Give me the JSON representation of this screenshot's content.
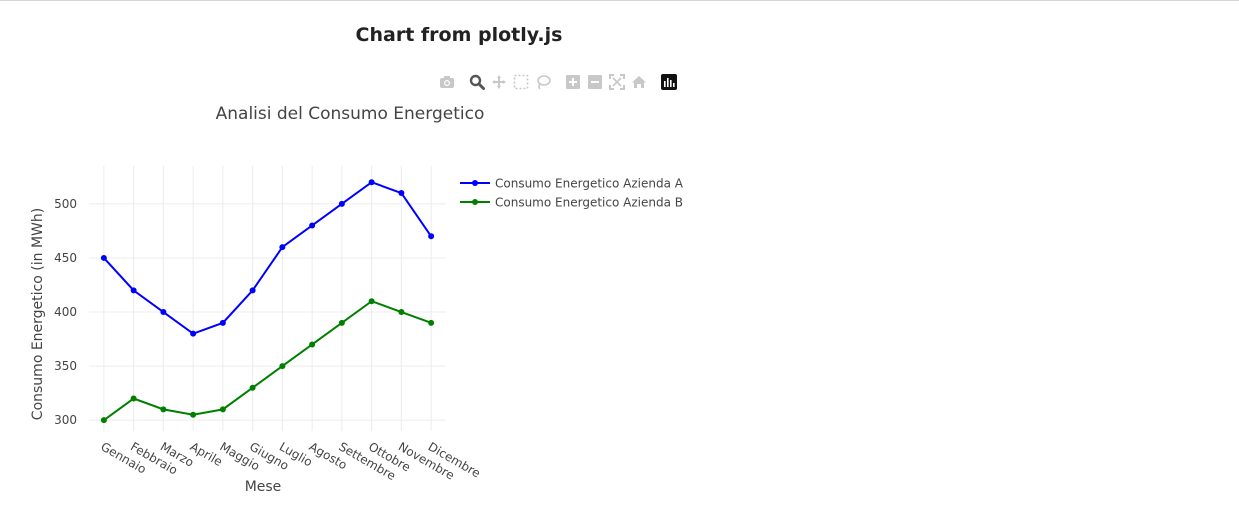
{
  "page": {
    "title": "Chart from plotly.js"
  },
  "modebar": {
    "buttons": [
      {
        "name": "camera-icon",
        "label": "Download plot as a png"
      },
      {
        "name": "zoom-icon",
        "label": "Zoom"
      },
      {
        "name": "pan-icon",
        "label": "Pan"
      },
      {
        "name": "box-select-icon",
        "label": "Box Select"
      },
      {
        "name": "lasso-select-icon",
        "label": "Lasso Select"
      },
      {
        "name": "zoom-in-icon",
        "label": "Zoom in"
      },
      {
        "name": "zoom-out-icon",
        "label": "Zoom out"
      },
      {
        "name": "autoscale-icon",
        "label": "Autoscale"
      },
      {
        "name": "reset-axes-icon",
        "label": "Reset axes"
      },
      {
        "name": "plotly-logo-icon",
        "label": "Produced with Plotly"
      }
    ],
    "active": "zoom-icon"
  },
  "chart_data": {
    "type": "line",
    "title": "Analisi del Consumo Energetico",
    "xlabel": "Mese",
    "ylabel": "Consumo Energetico (in MWh)",
    "categories": [
      "Gennaio",
      "Febbraio",
      "Marzo",
      "Aprile",
      "Maggio",
      "Giugno",
      "Luglio",
      "Agosto",
      "Settembre",
      "Ottobre",
      "Novembre",
      "Dicembre"
    ],
    "ylim": [
      290,
      535
    ],
    "yticks": [
      300,
      350,
      400,
      450,
      500
    ],
    "grid": true,
    "legend_position": "top-right",
    "series": [
      {
        "name": "Consumo Energetico Azienda A",
        "color": "#0000ff",
        "values": [
          450,
          420,
          400,
          380,
          390,
          420,
          460,
          480,
          500,
          520,
          510,
          470
        ]
      },
      {
        "name": "Consumo Energetico Azienda B",
        "color": "#008000",
        "values": [
          300,
          320,
          310,
          305,
          310,
          330,
          350,
          370,
          390,
          410,
          400,
          390
        ]
      }
    ]
  }
}
